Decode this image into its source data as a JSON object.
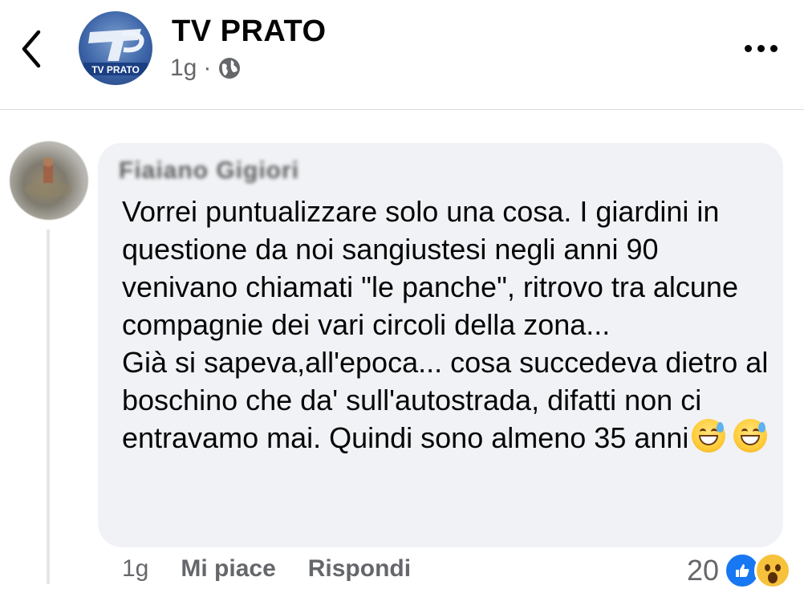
{
  "header": {
    "page_name": "TV PRATO",
    "time": "1g",
    "separator": "·",
    "audience_icon": "globe-icon",
    "logo_text": "TV PRATO",
    "back_icon": "chevron-left-icon",
    "more_icon": "more-horizontal-icon"
  },
  "comment": {
    "author": "Fiaiano Gigiori",
    "paragraph1": "Vorrei puntualizzare solo una cosa. I giardini in questione da noi sangiustesi negli anni 90 venivano chiamati \"le panche\", ritrovo tra alcune compagnie dei vari circoli della zona...",
    "paragraph2": "Già si sapeva,all'epoca... cosa succedeva dietro al boschino che da' sull'autostrada, difatti non ci entravamo mai. Quindi sono almeno 35 anni",
    "emoji": "grinning-sweat-emoji",
    "actions": {
      "time": "1g",
      "like": "Mi piace",
      "reply": "Rispondi"
    },
    "reactions": {
      "count": "20",
      "types": [
        "like-icon",
        "wow-icon"
      ]
    }
  },
  "colors": {
    "bubble": "#f0f2f5",
    "secondary_text": "#65676b",
    "like_blue": "#1877f2"
  }
}
